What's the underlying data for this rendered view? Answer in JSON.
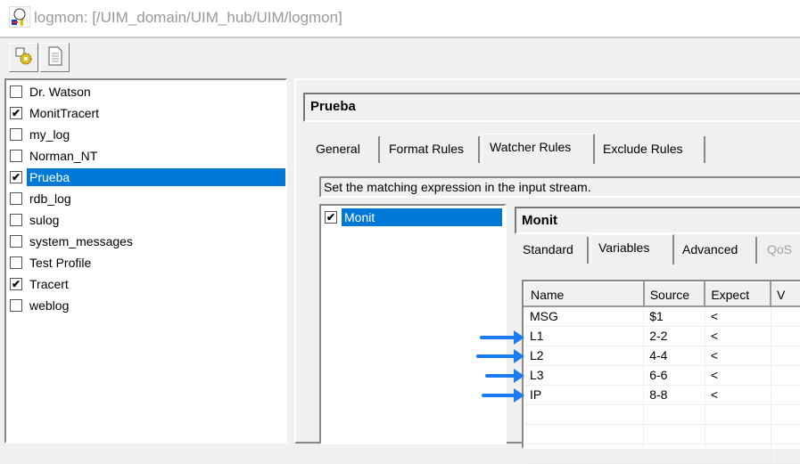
{
  "window": {
    "title": "logmon: [/UIM_domain/UIM_hub/UIM/logmon]"
  },
  "toolbar": {
    "buttons": [
      {
        "icon": "settings-gear-icon"
      },
      {
        "icon": "document-icon"
      }
    ]
  },
  "profiles": [
    {
      "label": "Dr. Watson",
      "checked": false
    },
    {
      "label": "MonitTracert",
      "checked": true
    },
    {
      "label": "my_log",
      "checked": false
    },
    {
      "label": "Norman_NT",
      "checked": false
    },
    {
      "label": "Prueba",
      "checked": true,
      "selected": true
    },
    {
      "label": "rdb_log",
      "checked": false
    },
    {
      "label": "sulog",
      "checked": false
    },
    {
      "label": "system_messages",
      "checked": false
    },
    {
      "label": "Test Profile",
      "checked": false
    },
    {
      "label": "Tracert",
      "checked": true
    },
    {
      "label": "weblog",
      "checked": false
    }
  ],
  "profile_panel": {
    "title": "Prueba",
    "tabs": [
      "General",
      "Format Rules",
      "Watcher Rules",
      "Exclude Rules"
    ],
    "active_tab": "Watcher Rules",
    "description": "Set the matching expression in the input stream.",
    "watchers": [
      {
        "label": "Monit",
        "checked": true,
        "selected": true
      }
    ]
  },
  "watcher_panel": {
    "title": "Monit",
    "tabs": [
      "Standard",
      "Variables",
      "Advanced",
      "QoS"
    ],
    "active_tab": "Variables",
    "columns": [
      "Name",
      "Source",
      "Expect",
      "V"
    ],
    "rows": [
      [
        "MSG",
        "$1",
        "<"
      ],
      [
        "L1",
        "2-2",
        "<"
      ],
      [
        "L2",
        "4-4",
        "<"
      ],
      [
        "L3",
        "6-6",
        "<"
      ],
      [
        "IP",
        "8-8",
        "<"
      ]
    ]
  },
  "colors": {
    "selection": "#0078d7",
    "arrow": "#1a7cf0"
  }
}
